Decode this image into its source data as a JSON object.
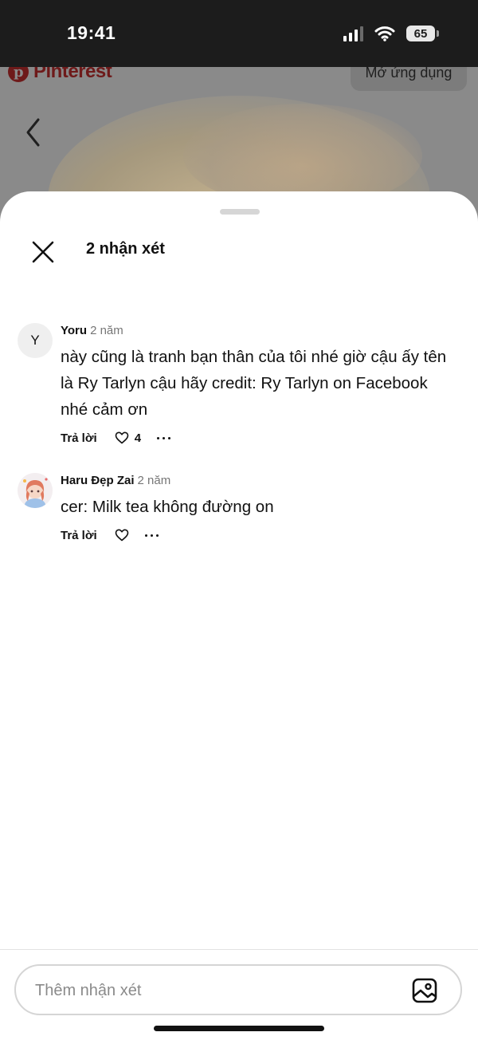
{
  "status_bar": {
    "time": "19:41",
    "battery": "65",
    "icons": [
      "signal-icon",
      "wifi-icon",
      "battery-icon"
    ]
  },
  "background_page": {
    "logo": "Pinterest",
    "open_app_label": "Mở ứng dụng",
    "icons": [
      "pinterest-logo-icon",
      "back-chevron-icon"
    ]
  },
  "sheet": {
    "title": "2 nhận xét",
    "icons": [
      "close-icon"
    ]
  },
  "comments": [
    {
      "avatar_initial": "Y",
      "author": "Yoru",
      "time": "2 năm",
      "text": "này cũng là tranh bạn thân của tôi nhé giờ cậu ấy tên là Ry Tarlyn cậu hãy credit: Ry Tarlyn on Facebook nhé cảm ơn",
      "reply_label": "Trả lời",
      "likes": "4"
    },
    {
      "avatar_initial": "",
      "author": "Haru Đẹp Zai",
      "time": "2 năm",
      "text": "cer: Milk tea không đường on",
      "reply_label": "Trả lời",
      "likes": ""
    }
  ],
  "composer": {
    "placeholder": "Thêm nhận xét",
    "icons": [
      "image-icon"
    ]
  },
  "colors": {
    "overlay": "#8a8a8a",
    "status_bar": "#1c1c1c",
    "text": "#111111",
    "muted": "#767676",
    "border": "#d5d5d5"
  }
}
